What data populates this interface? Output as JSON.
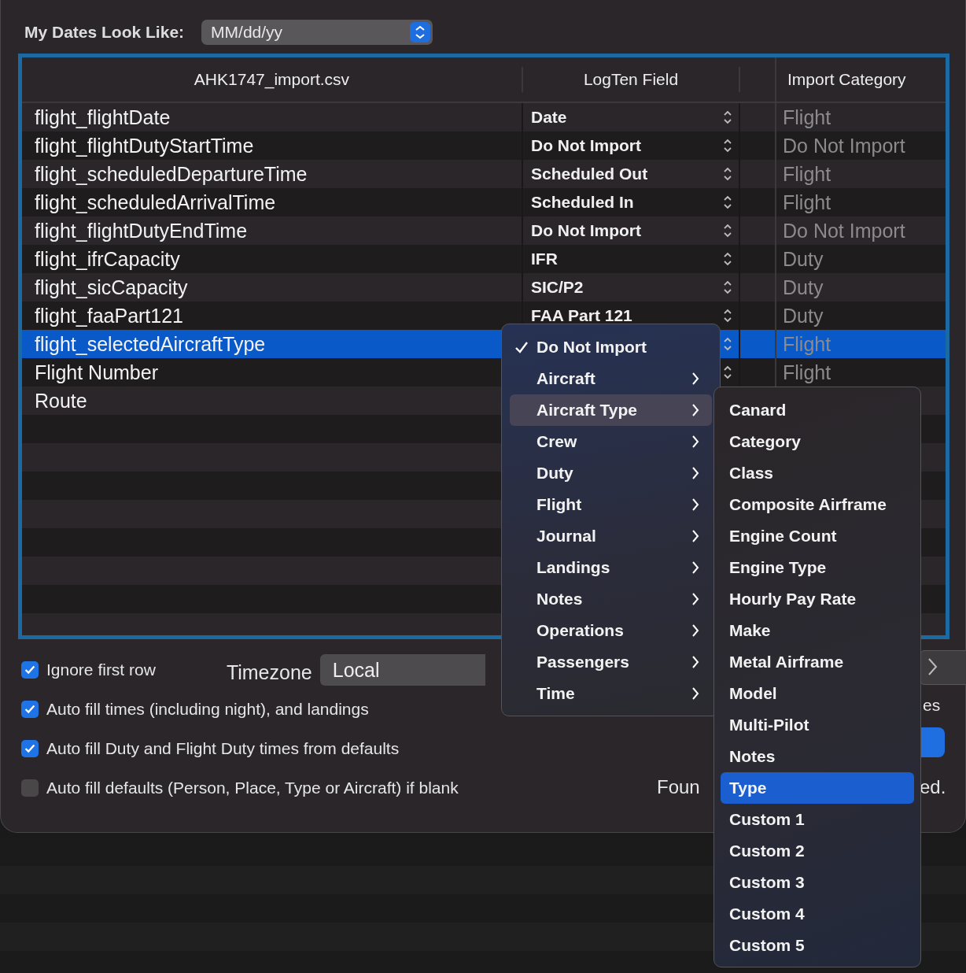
{
  "dates": {
    "label": "My Dates Look Like:",
    "value": "MM/dd/yy"
  },
  "table": {
    "columns": [
      "AHK1747_import.csv",
      "LogTen Field",
      "Import Category"
    ],
    "rows": [
      {
        "source": "flight_flightDate",
        "field": "Date",
        "category": "Flight",
        "selected": false
      },
      {
        "source": "flight_flightDutyStartTime",
        "field": "Do Not Import",
        "category": "Do Not Import",
        "selected": false
      },
      {
        "source": "flight_scheduledDepartureTime",
        "field": "Scheduled Out",
        "category": "Flight",
        "selected": false
      },
      {
        "source": "flight_scheduledArrivalTime",
        "field": "Scheduled In",
        "category": "Flight",
        "selected": false
      },
      {
        "source": "flight_flightDutyEndTime",
        "field": "Do Not Import",
        "category": "Do Not Import",
        "selected": false
      },
      {
        "source": "flight_ifrCapacity",
        "field": "IFR",
        "category": "Duty",
        "selected": false
      },
      {
        "source": "flight_sicCapacity",
        "field": "SIC/P2",
        "category": "Duty",
        "selected": false
      },
      {
        "source": "flight_faaPart121",
        "field": "FAA Part 121",
        "category": "Duty",
        "selected": false
      },
      {
        "source": "flight_selectedAircraftType",
        "category": "Flight",
        "selected": true
      },
      {
        "source": "Flight Number",
        "category": "Flight",
        "selected": false
      },
      {
        "source": "Route",
        "selected": false
      }
    ]
  },
  "options": [
    {
      "label": "Ignore first row",
      "checked": true
    },
    {
      "label": "Auto fill times (including night), and landings",
      "checked": true
    },
    {
      "label": "Auto fill Duty and Flight Duty times from defaults",
      "checked": true
    },
    {
      "label": "Auto fill defaults (Person, Place, Type or Aircraft) if blank",
      "checked": false
    }
  ],
  "timezone": {
    "label": "Timezone",
    "value": "Local"
  },
  "partial_texts": [
    "es",
    "Foun",
    "ed."
  ],
  "menu": [
    {
      "label": "Do Not Import",
      "checked": true,
      "selected": false,
      "submenu": false
    },
    {
      "label": "Aircraft",
      "checked": false,
      "selected": false,
      "submenu": true
    },
    {
      "label": "Aircraft Type",
      "checked": false,
      "selected": true,
      "submenu": true
    },
    {
      "label": "Crew",
      "checked": false,
      "selected": false,
      "submenu": true
    },
    {
      "label": "Duty",
      "checked": false,
      "selected": false,
      "submenu": true
    },
    {
      "label": "Flight",
      "checked": false,
      "selected": false,
      "submenu": true
    },
    {
      "label": "Journal",
      "checked": false,
      "selected": false,
      "submenu": true
    },
    {
      "label": "Landings",
      "checked": false,
      "selected": false,
      "submenu": true
    },
    {
      "label": "Notes",
      "checked": false,
      "selected": false,
      "submenu": true
    },
    {
      "label": "Operations",
      "checked": false,
      "selected": false,
      "submenu": true
    },
    {
      "label": "Passengers",
      "checked": false,
      "selected": false,
      "submenu": true
    },
    {
      "label": "Time",
      "checked": false,
      "selected": false,
      "submenu": true
    }
  ],
  "submenu": [
    {
      "label": "Canard",
      "selected": false
    },
    {
      "label": "Category",
      "selected": false
    },
    {
      "label": "Class",
      "selected": false
    },
    {
      "label": "Composite Airframe",
      "selected": false
    },
    {
      "label": "Engine Count",
      "selected": false
    },
    {
      "label": "Engine Type",
      "selected": false
    },
    {
      "label": "Hourly Pay Rate",
      "selected": false
    },
    {
      "label": "Make",
      "selected": false
    },
    {
      "label": "Metal Airframe",
      "selected": false
    },
    {
      "label": "Model",
      "selected": false
    },
    {
      "label": "Multi-Pilot",
      "selected": false
    },
    {
      "label": "Notes",
      "selected": false
    },
    {
      "label": "Type",
      "selected": true
    },
    {
      "label": "Custom 1",
      "selected": false
    },
    {
      "label": "Custom 2",
      "selected": false
    },
    {
      "label": "Custom 3",
      "selected": false
    },
    {
      "label": "Custom 4",
      "selected": false
    },
    {
      "label": "Custom 5",
      "selected": false
    }
  ]
}
